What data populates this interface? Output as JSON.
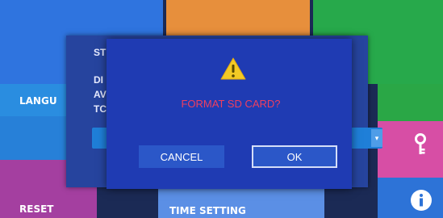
{
  "background": {
    "labels": {
      "language": "LANGU",
      "reset": "RESET",
      "time_setting": "TIME SETTING"
    },
    "panel_lines": [
      "ST",
      "DI",
      "AV",
      "TC"
    ],
    "icons": {
      "key": "key-icon",
      "info": "info-icon"
    }
  },
  "dialog": {
    "icon": "warning-icon",
    "message": "FORMAT SD CARD?",
    "cancel_label": "CANCEL",
    "ok_label": "OK"
  },
  "colors": {
    "message": "#ef3f5f",
    "dialog_bg": "#1f3bb3",
    "warning": "#f3ca25"
  }
}
